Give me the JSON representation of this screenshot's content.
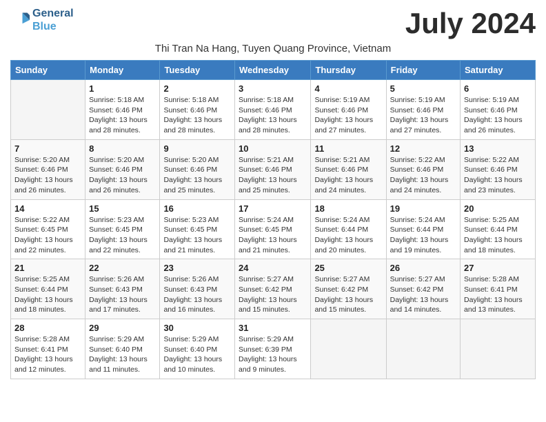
{
  "header": {
    "logo_line1": "General",
    "logo_line2": "Blue",
    "month_year": "July 2024",
    "subtitle": "Thi Tran Na Hang, Tuyen Quang Province, Vietnam"
  },
  "weekdays": [
    "Sunday",
    "Monday",
    "Tuesday",
    "Wednesday",
    "Thursday",
    "Friday",
    "Saturday"
  ],
  "weeks": [
    [
      {
        "day": "",
        "detail": ""
      },
      {
        "day": "1",
        "detail": "Sunrise: 5:18 AM\nSunset: 6:46 PM\nDaylight: 13 hours\nand 28 minutes."
      },
      {
        "day": "2",
        "detail": "Sunrise: 5:18 AM\nSunset: 6:46 PM\nDaylight: 13 hours\nand 28 minutes."
      },
      {
        "day": "3",
        "detail": "Sunrise: 5:18 AM\nSunset: 6:46 PM\nDaylight: 13 hours\nand 28 minutes."
      },
      {
        "day": "4",
        "detail": "Sunrise: 5:19 AM\nSunset: 6:46 PM\nDaylight: 13 hours\nand 27 minutes."
      },
      {
        "day": "5",
        "detail": "Sunrise: 5:19 AM\nSunset: 6:46 PM\nDaylight: 13 hours\nand 27 minutes."
      },
      {
        "day": "6",
        "detail": "Sunrise: 5:19 AM\nSunset: 6:46 PM\nDaylight: 13 hours\nand 26 minutes."
      }
    ],
    [
      {
        "day": "7",
        "detail": "Sunrise: 5:20 AM\nSunset: 6:46 PM\nDaylight: 13 hours\nand 26 minutes."
      },
      {
        "day": "8",
        "detail": "Sunrise: 5:20 AM\nSunset: 6:46 PM\nDaylight: 13 hours\nand 26 minutes."
      },
      {
        "day": "9",
        "detail": "Sunrise: 5:20 AM\nSunset: 6:46 PM\nDaylight: 13 hours\nand 25 minutes."
      },
      {
        "day": "10",
        "detail": "Sunrise: 5:21 AM\nSunset: 6:46 PM\nDaylight: 13 hours\nand 25 minutes."
      },
      {
        "day": "11",
        "detail": "Sunrise: 5:21 AM\nSunset: 6:46 PM\nDaylight: 13 hours\nand 24 minutes."
      },
      {
        "day": "12",
        "detail": "Sunrise: 5:22 AM\nSunset: 6:46 PM\nDaylight: 13 hours\nand 24 minutes."
      },
      {
        "day": "13",
        "detail": "Sunrise: 5:22 AM\nSunset: 6:46 PM\nDaylight: 13 hours\nand 23 minutes."
      }
    ],
    [
      {
        "day": "14",
        "detail": "Sunrise: 5:22 AM\nSunset: 6:45 PM\nDaylight: 13 hours\nand 22 minutes."
      },
      {
        "day": "15",
        "detail": "Sunrise: 5:23 AM\nSunset: 6:45 PM\nDaylight: 13 hours\nand 22 minutes."
      },
      {
        "day": "16",
        "detail": "Sunrise: 5:23 AM\nSunset: 6:45 PM\nDaylight: 13 hours\nand 21 minutes."
      },
      {
        "day": "17",
        "detail": "Sunrise: 5:24 AM\nSunset: 6:45 PM\nDaylight: 13 hours\nand 21 minutes."
      },
      {
        "day": "18",
        "detail": "Sunrise: 5:24 AM\nSunset: 6:44 PM\nDaylight: 13 hours\nand 20 minutes."
      },
      {
        "day": "19",
        "detail": "Sunrise: 5:24 AM\nSunset: 6:44 PM\nDaylight: 13 hours\nand 19 minutes."
      },
      {
        "day": "20",
        "detail": "Sunrise: 5:25 AM\nSunset: 6:44 PM\nDaylight: 13 hours\nand 18 minutes."
      }
    ],
    [
      {
        "day": "21",
        "detail": "Sunrise: 5:25 AM\nSunset: 6:44 PM\nDaylight: 13 hours\nand 18 minutes."
      },
      {
        "day": "22",
        "detail": "Sunrise: 5:26 AM\nSunset: 6:43 PM\nDaylight: 13 hours\nand 17 minutes."
      },
      {
        "day": "23",
        "detail": "Sunrise: 5:26 AM\nSunset: 6:43 PM\nDaylight: 13 hours\nand 16 minutes."
      },
      {
        "day": "24",
        "detail": "Sunrise: 5:27 AM\nSunset: 6:42 PM\nDaylight: 13 hours\nand 15 minutes."
      },
      {
        "day": "25",
        "detail": "Sunrise: 5:27 AM\nSunset: 6:42 PM\nDaylight: 13 hours\nand 15 minutes."
      },
      {
        "day": "26",
        "detail": "Sunrise: 5:27 AM\nSunset: 6:42 PM\nDaylight: 13 hours\nand 14 minutes."
      },
      {
        "day": "27",
        "detail": "Sunrise: 5:28 AM\nSunset: 6:41 PM\nDaylight: 13 hours\nand 13 minutes."
      }
    ],
    [
      {
        "day": "28",
        "detail": "Sunrise: 5:28 AM\nSunset: 6:41 PM\nDaylight: 13 hours\nand 12 minutes."
      },
      {
        "day": "29",
        "detail": "Sunrise: 5:29 AM\nSunset: 6:40 PM\nDaylight: 13 hours\nand 11 minutes."
      },
      {
        "day": "30",
        "detail": "Sunrise: 5:29 AM\nSunset: 6:40 PM\nDaylight: 13 hours\nand 10 minutes."
      },
      {
        "day": "31",
        "detail": "Sunrise: 5:29 AM\nSunset: 6:39 PM\nDaylight: 13 hours\nand 9 minutes."
      },
      {
        "day": "",
        "detail": ""
      },
      {
        "day": "",
        "detail": ""
      },
      {
        "day": "",
        "detail": ""
      }
    ]
  ]
}
